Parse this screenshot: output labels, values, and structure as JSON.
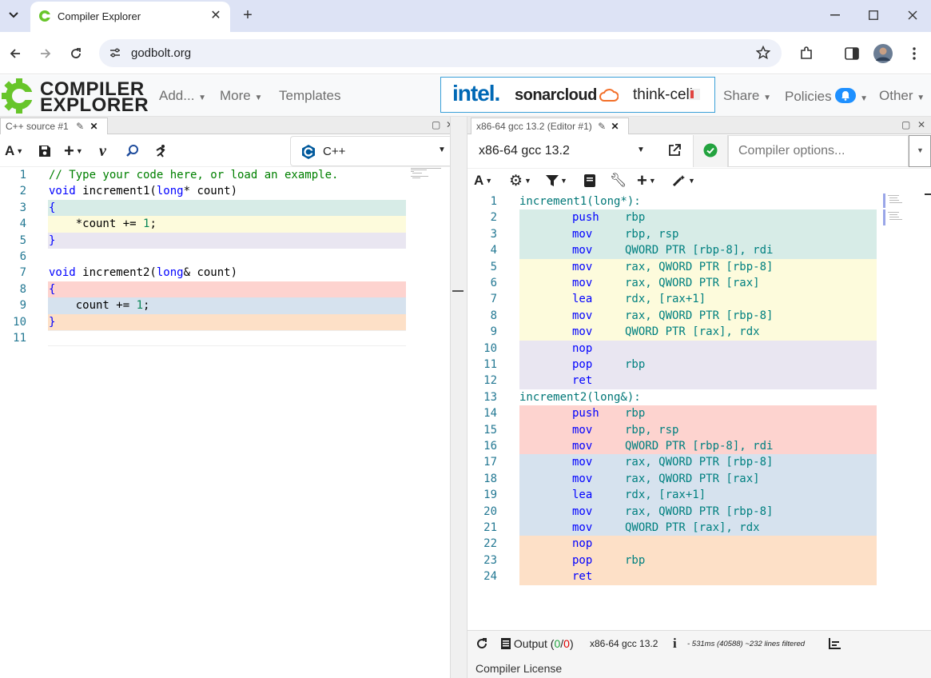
{
  "browser": {
    "tab_title": "Compiler Explorer",
    "url": "godbolt.org"
  },
  "ce": {
    "logo_line1": "COMPILER",
    "logo_line2": "EXPLORER",
    "menu": {
      "add": "Add...",
      "more": "More",
      "templates": "Templates",
      "share": "Share",
      "policies": "Policies",
      "other": "Other"
    },
    "sponsors": {
      "intel": "intel.",
      "sonarcloud": "sonarcloud",
      "thinkcell": "think-cell"
    }
  },
  "source_pane": {
    "tab_label": "C++ source #1",
    "language": "C++",
    "lines": [
      {
        "n": "1",
        "bg": "#ffffff"
      },
      {
        "n": "2",
        "bg": "#ffffff"
      },
      {
        "n": "3",
        "bg": "#d7ece7"
      },
      {
        "n": "4",
        "bg": "#fdfbdc"
      },
      {
        "n": "5",
        "bg": "#e9e6f1"
      },
      {
        "n": "6",
        "bg": "#ffffff"
      },
      {
        "n": "7",
        "bg": "#ffffff"
      },
      {
        "n": "8",
        "bg": "#fdd3cf"
      },
      {
        "n": "9",
        "bg": "#d6e2ee"
      },
      {
        "n": "10",
        "bg": "#fde0c7"
      },
      {
        "n": "11",
        "bg": "#ffffff"
      }
    ],
    "code": {
      "l1": "// Type your code here, or load an example.",
      "l2_kw": "void",
      "l2_fn": " increment1(",
      "l2_type": "long",
      "l2_rest": "* count)",
      "l3": "{",
      "l4_a": "    *count += ",
      "l4_num": "1",
      "l4_b": ";",
      "l5": "}",
      "l7_kw": "void",
      "l7_fn": " increment2(",
      "l7_type": "long",
      "l7_rest": "& count)",
      "l8": "{",
      "l9_a": "    count += ",
      "l9_num": "1",
      "l9_b": ";",
      "l10": "}"
    }
  },
  "asm_pane": {
    "tab_label": "x86-64 gcc 13.2 (Editor #1)",
    "compiler": "x86-64 gcc 13.2",
    "options_placeholder": "Compiler options...",
    "lines": [
      {
        "n": "1",
        "bg": "#ffffff",
        "label": "increment1(long*):",
        "op": "",
        "args": ""
      },
      {
        "n": "2",
        "bg": "#d7ece7",
        "label": "",
        "op": "push",
        "args": "rbp"
      },
      {
        "n": "3",
        "bg": "#d7ece7",
        "label": "",
        "op": "mov",
        "args": "rbp, rsp"
      },
      {
        "n": "4",
        "bg": "#d7ece7",
        "label": "",
        "op": "mov",
        "args": "QWORD PTR [rbp-8], rdi"
      },
      {
        "n": "5",
        "bg": "#fdfbdc",
        "label": "",
        "op": "mov",
        "args": "rax, QWORD PTR [rbp-8]"
      },
      {
        "n": "6",
        "bg": "#fdfbdc",
        "label": "",
        "op": "mov",
        "args": "rax, QWORD PTR [rax]"
      },
      {
        "n": "7",
        "bg": "#fdfbdc",
        "label": "",
        "op": "lea",
        "args": "rdx, [rax+1]"
      },
      {
        "n": "8",
        "bg": "#fdfbdc",
        "label": "",
        "op": "mov",
        "args": "rax, QWORD PTR [rbp-8]"
      },
      {
        "n": "9",
        "bg": "#fdfbdc",
        "label": "",
        "op": "mov",
        "args": "QWORD PTR [rax], rdx"
      },
      {
        "n": "10",
        "bg": "#e9e6f1",
        "label": "",
        "op": "nop",
        "args": ""
      },
      {
        "n": "11",
        "bg": "#e9e6f1",
        "label": "",
        "op": "pop",
        "args": "rbp"
      },
      {
        "n": "12",
        "bg": "#e9e6f1",
        "label": "",
        "op": "ret",
        "args": ""
      },
      {
        "n": "13",
        "bg": "#ffffff",
        "label": "increment2(long&):",
        "op": "",
        "args": ""
      },
      {
        "n": "14",
        "bg": "#fdd3cf",
        "label": "",
        "op": "push",
        "args": "rbp"
      },
      {
        "n": "15",
        "bg": "#fdd3cf",
        "label": "",
        "op": "mov",
        "args": "rbp, rsp"
      },
      {
        "n": "16",
        "bg": "#fdd3cf",
        "label": "",
        "op": "mov",
        "args": "QWORD PTR [rbp-8], rdi"
      },
      {
        "n": "17",
        "bg": "#d6e2ee",
        "label": "",
        "op": "mov",
        "args": "rax, QWORD PTR [rbp-8]"
      },
      {
        "n": "18",
        "bg": "#d6e2ee",
        "label": "",
        "op": "mov",
        "args": "rax, QWORD PTR [rax]"
      },
      {
        "n": "19",
        "bg": "#d6e2ee",
        "label": "",
        "op": "lea",
        "args": "rdx, [rax+1]"
      },
      {
        "n": "20",
        "bg": "#d6e2ee",
        "label": "",
        "op": "mov",
        "args": "rax, QWORD PTR [rbp-8]"
      },
      {
        "n": "21",
        "bg": "#d6e2ee",
        "label": "",
        "op": "mov",
        "args": "QWORD PTR [rax], rdx"
      },
      {
        "n": "22",
        "bg": "#fde0c7",
        "label": "",
        "op": "nop",
        "args": ""
      },
      {
        "n": "23",
        "bg": "#fde0c7",
        "label": "",
        "op": "pop",
        "args": "rbp"
      },
      {
        "n": "24",
        "bg": "#fde0c7",
        "label": "",
        "op": "ret",
        "args": ""
      }
    ],
    "output": {
      "label": "Output (",
      "count_ok": "0",
      "slash": "/",
      "count_err": "0",
      "close": ")",
      "compiler": "x86-64 gcc 13.2",
      "stats": "- 531ms (40588) ~232 lines filtered"
    },
    "license": "Compiler License"
  },
  "colors": {
    "accent": "#67c52a",
    "link": "#3aa0d8"
  }
}
